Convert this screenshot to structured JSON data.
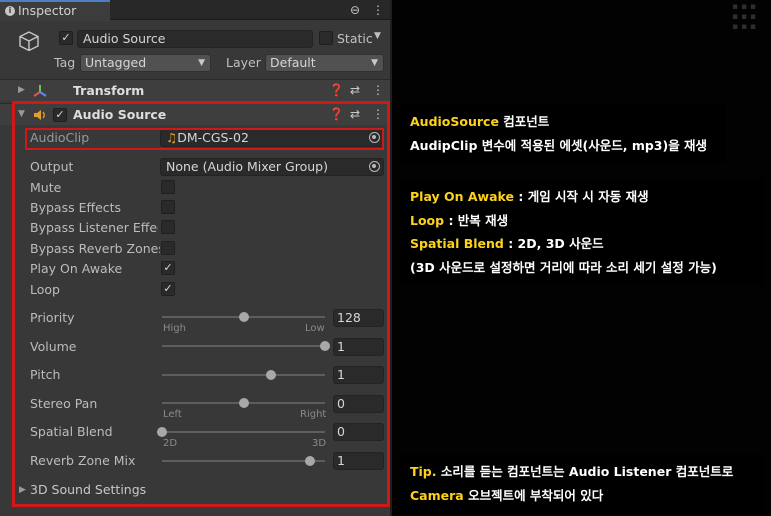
{
  "window": {
    "tab_title": "Inspector",
    "lock_glyph": "⊖",
    "menu_glyph": "⋮"
  },
  "gameobject": {
    "active_check": "✓",
    "name": "Audio Source",
    "static_label": "Static",
    "tag_label": "Tag",
    "tag_value": "Untagged",
    "layer_label": "Layer",
    "layer_value": "Default"
  },
  "transform": {
    "title": "Transform"
  },
  "audio_source": {
    "title": "Audio Source",
    "enabled_check": "✓",
    "audioclip_label": "AudioClip",
    "audioclip_value": "DM-CGS-02",
    "audioclip_icon": "♫",
    "output_label": "Output",
    "output_value": "None (Audio Mixer Group)",
    "mute_label": "Mute",
    "bypass_effects_label": "Bypass Effects",
    "bypass_listener_label": "Bypass Listener Effec",
    "bypass_reverb_label": "Bypass Reverb Zones",
    "play_on_awake_label": "Play On Awake",
    "play_on_awake_check": "✓",
    "loop_label": "Loop",
    "loop_check": "✓",
    "priority": {
      "label": "Priority",
      "value": "128",
      "fraction": 0.5,
      "min_label": "High",
      "max_label": "Low"
    },
    "volume": {
      "label": "Volume",
      "value": "1",
      "fraction": 1.0
    },
    "pitch": {
      "label": "Pitch",
      "value": "1",
      "fraction": 0.67
    },
    "stereo_pan": {
      "label": "Stereo Pan",
      "value": "0",
      "fraction": 0.5,
      "min_label": "Left",
      "max_label": "Right"
    },
    "spatial_blend": {
      "label": "Spatial Blend",
      "value": "0",
      "fraction": 0.0,
      "min_label": "2D",
      "max_label": "3D"
    },
    "reverb_mix": {
      "label": "Reverb Zone Mix",
      "value": "1",
      "fraction": 0.91
    },
    "sound_settings_label": "3D Sound Settings"
  },
  "notes": {
    "note1": {
      "line1_hl": "AudioSource",
      "line1_rest": " 컴포넌트",
      "line2": "AudipClip 변수에 적용된 에셋(사운드, mp3)을 재생"
    },
    "note2": {
      "l1_hl": "Play On Awake",
      "l1_rest": " : 게임 시작 시 자동 재생",
      "l2_hl": "Loop",
      "l2_rest": " : 반복 재생",
      "l3_hl": "Spatial Blend",
      "l3_rest": " : 2D, 3D 사운드",
      "l4": "(3D 사운드로 설정하면 거리에 따라 소리 세기 설정 가능)"
    },
    "note3": {
      "l1_hl": "Tip.",
      "l1_rest": " 소리를 듣는 컴포넌트는 Audio Listener 컴포넌트로",
      "l2_hl": "Camera",
      "l2_rest": " 오브젝트에 부착되어 있다"
    }
  },
  "colors": {
    "highlight_red": "#d01818",
    "note_yellow": "#ffd21a",
    "tab_accent": "#4d7fc7"
  }
}
